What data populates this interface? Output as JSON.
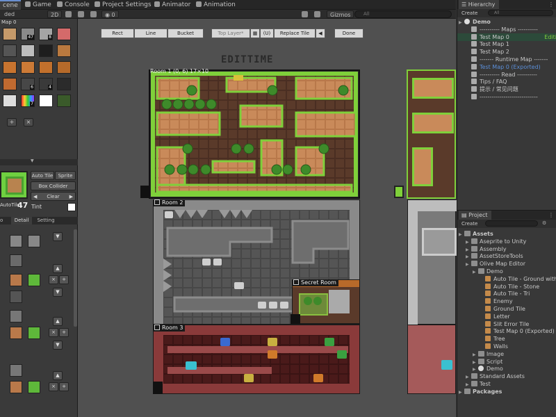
{
  "tabs": [
    {
      "label": "cene",
      "icon": "scene-icon",
      "active": true
    },
    {
      "label": "Game",
      "icon": "game-icon"
    },
    {
      "label": "Console",
      "icon": "console-icon"
    },
    {
      "label": "Project Settings",
      "icon": "gear-icon"
    },
    {
      "label": "Animator",
      "icon": "animator-icon"
    },
    {
      "label": "Animation",
      "icon": "animation-icon"
    }
  ],
  "scene_toolbar": {
    "shading": "ded",
    "mode_2d": "2D",
    "hidden_count": "0",
    "gizmos": "Gizmos",
    "search_placeholder": "All"
  },
  "left_panel": {
    "map_label": "Map 0",
    "tile_badges": [
      "47",
      "8",
      "6",
      "4",
      "7"
    ],
    "autotile_title": "AutoTile",
    "autotile_count": "47",
    "buttons": {
      "auto_tile": "Auto Tile",
      "sprite": "Sprite",
      "box_collider": "Box Collider",
      "clear": "Clear",
      "tint": "Tint"
    },
    "subtabs": [
      "o",
      "Detail",
      "Setting"
    ],
    "add": "+",
    "remove": "×"
  },
  "map_toolbar": {
    "rect": "Rect",
    "line": "Line",
    "bucket": "Bucket",
    "top_layer": "Top Layer*",
    "layer_index": "(U)",
    "replace_tile": "Replace Tile",
    "done": "Done"
  },
  "scene": {
    "title": "EDITTIME",
    "room1": "Room 1  (0, 6)  17×10",
    "room2": "Room 2",
    "secret_room": "Secret Room",
    "room3": "Room 3"
  },
  "hierarchy": {
    "title": "Hierarchy",
    "create": "Create",
    "search_placeholder": "All",
    "items": [
      {
        "label": "Demo",
        "indent": 0,
        "type": "scene",
        "bold": true
      },
      {
        "label": "---------- Maps ----------",
        "indent": 1,
        "type": "cube"
      },
      {
        "label": "Test Map 0",
        "indent": 1,
        "type": "cube",
        "selected": true,
        "extra": "Editi"
      },
      {
        "label": "Test Map 1",
        "indent": 1,
        "type": "cube"
      },
      {
        "label": "Test Map 2",
        "indent": 1,
        "type": "cube"
      },
      {
        "label": "------- Runtime Map -------",
        "indent": 1,
        "type": "cube"
      },
      {
        "label": "Test Map 0 (Exported)",
        "indent": 1,
        "type": "cube",
        "color": "#5b8fd9"
      },
      {
        "label": "---------- Read ----------",
        "indent": 1,
        "type": "cube"
      },
      {
        "label": "Tips / FAQ",
        "indent": 1,
        "type": "cube"
      },
      {
        "label": "提示 / 常见问题",
        "indent": 1,
        "type": "cube"
      },
      {
        "label": "-----------------------------",
        "indent": 1,
        "type": "cube"
      }
    ]
  },
  "project": {
    "title": "Project",
    "create": "Create",
    "items": [
      {
        "label": "Assets",
        "indent": 0,
        "type": "folder",
        "bold": true
      },
      {
        "label": "Aseprite to Unity",
        "indent": 1,
        "type": "folder"
      },
      {
        "label": "Assembly",
        "indent": 1,
        "type": "folder"
      },
      {
        "label": "AssetStoreTools",
        "indent": 1,
        "type": "folder"
      },
      {
        "label": "Olive Map Editor",
        "indent": 1,
        "type": "folder"
      },
      {
        "label": "Demo",
        "indent": 2,
        "type": "folder"
      },
      {
        "label": "Auto Tile - Ground with",
        "indent": 3,
        "type": "asset"
      },
      {
        "label": "Auto Tile - Stone",
        "indent": 3,
        "type": "asset"
      },
      {
        "label": "Auto Tile - Tri",
        "indent": 3,
        "type": "asset"
      },
      {
        "label": "Enemy",
        "indent": 3,
        "type": "asset"
      },
      {
        "label": "Ground Tile",
        "indent": 3,
        "type": "asset"
      },
      {
        "label": "Letter",
        "indent": 3,
        "type": "asset"
      },
      {
        "label": "Slit Error Tile",
        "indent": 3,
        "type": "asset"
      },
      {
        "label": "Test Map 0 (Exported)",
        "indent": 3,
        "type": "asset"
      },
      {
        "label": "Tree",
        "indent": 3,
        "type": "asset"
      },
      {
        "label": "Walls",
        "indent": 3,
        "type": "asset"
      },
      {
        "label": "Image",
        "indent": 2,
        "type": "folder"
      },
      {
        "label": "Script",
        "indent": 2,
        "type": "folder"
      },
      {
        "label": "Demo",
        "indent": 2,
        "type": "scene"
      },
      {
        "label": "Standard Assets",
        "indent": 1,
        "type": "folder"
      },
      {
        "label": "Test",
        "indent": 1,
        "type": "folder"
      },
      {
        "label": "Packages",
        "indent": 0,
        "type": "folder",
        "bold": true
      }
    ]
  },
  "colors": {
    "grass": "#7fd03a",
    "dirt": "#5a3a2a",
    "sand": "#c98a5a",
    "stone": "#6e6e6e",
    "lava": "#6b2a2a",
    "accent": "#5b8fd9"
  }
}
